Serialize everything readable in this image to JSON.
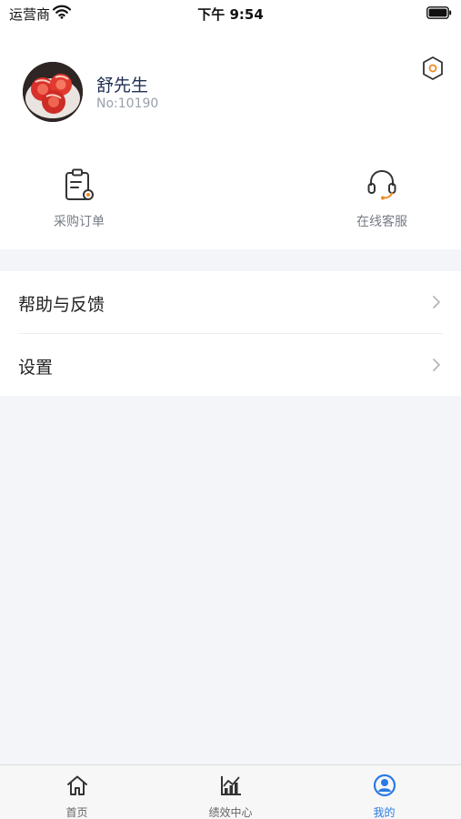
{
  "status_bar": {
    "carrier": "运营商",
    "time": "下午 9:54"
  },
  "profile": {
    "name": "舒先生",
    "number": "No:10190"
  },
  "quick_actions": [
    {
      "label": "采购订单",
      "icon": "clipboard-icon"
    },
    {
      "label": "在线客服",
      "icon": "headset-icon"
    }
  ],
  "menu": [
    {
      "label": "帮助与反馈"
    },
    {
      "label": "设置"
    }
  ],
  "tab_bar": {
    "tabs": [
      {
        "label": "首页",
        "icon": "home-icon"
      },
      {
        "label": "绩效中心",
        "icon": "chart-icon"
      },
      {
        "label": "我的",
        "icon": "user-circle-icon"
      }
    ],
    "active_index": 2
  },
  "colors": {
    "accent": "#2a7be2",
    "orange": "#f08a24",
    "background": "#f3f5f8"
  }
}
